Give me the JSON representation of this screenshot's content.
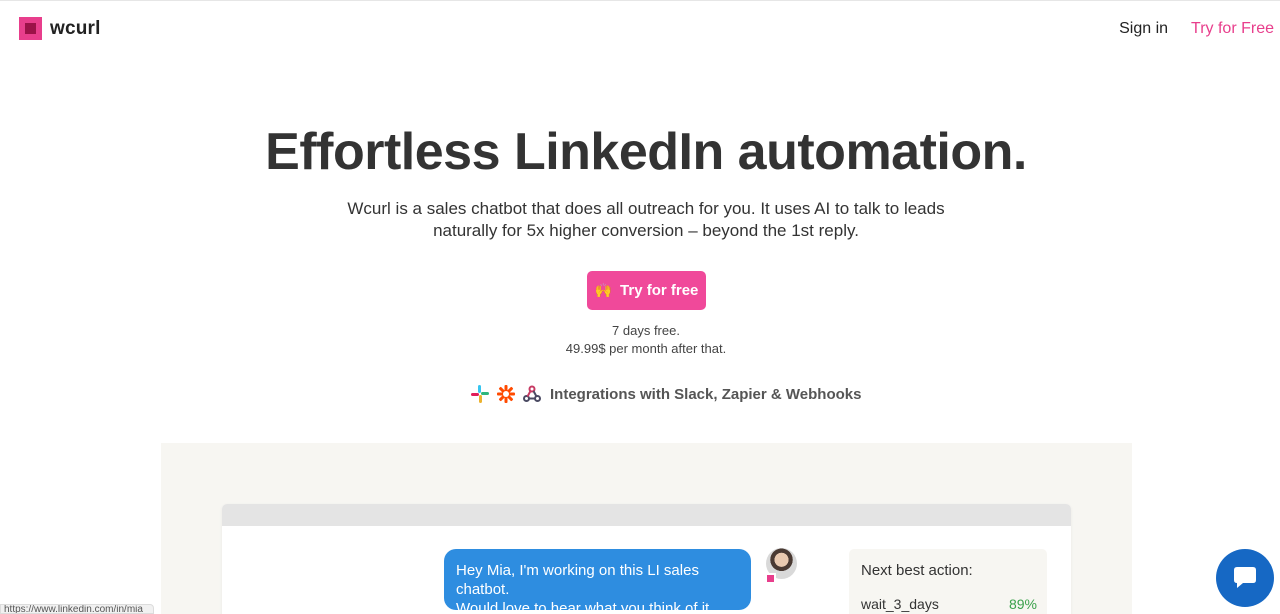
{
  "header": {
    "brand": "wcurl",
    "nav": {
      "signin_label": "Sign in",
      "tryfree_label": "Try for Free"
    }
  },
  "hero": {
    "title": "Effortless LinkedIn automation.",
    "subtitle_line1": "Wcurl is a sales chatbot that does all outreach for you. It uses AI to talk to leads",
    "subtitle_line2": "naturally for 5x higher conversion – beyond the 1st reply.",
    "cta_emoji": "🙌",
    "cta_label": "Try for free",
    "pricing_line1": "7 days free.",
    "pricing_line2": "49.99$ per month after that.",
    "integrations_label": "Integrations with Slack, Zapier & Webhooks"
  },
  "integration_icons": [
    "slack-icon",
    "zapier-icon",
    "webhooks-icon"
  ],
  "demo": {
    "message_line1": "Hey Mia, I'm working on this LI sales chatbot.",
    "message_line2": "Would love to hear what you think of it.",
    "next_best_action_title": "Next best action:",
    "action_name": "wait_3_days",
    "action_score": "89%"
  },
  "status_bar": {
    "url": "https://www.linkedin.com/in/mia"
  },
  "colors": {
    "brand_pink": "#e83e8c",
    "cta_pink": "#f0499a",
    "chat_blue": "#2e8de0",
    "fab_blue": "#1668c4",
    "score_green": "#3aa14b"
  }
}
